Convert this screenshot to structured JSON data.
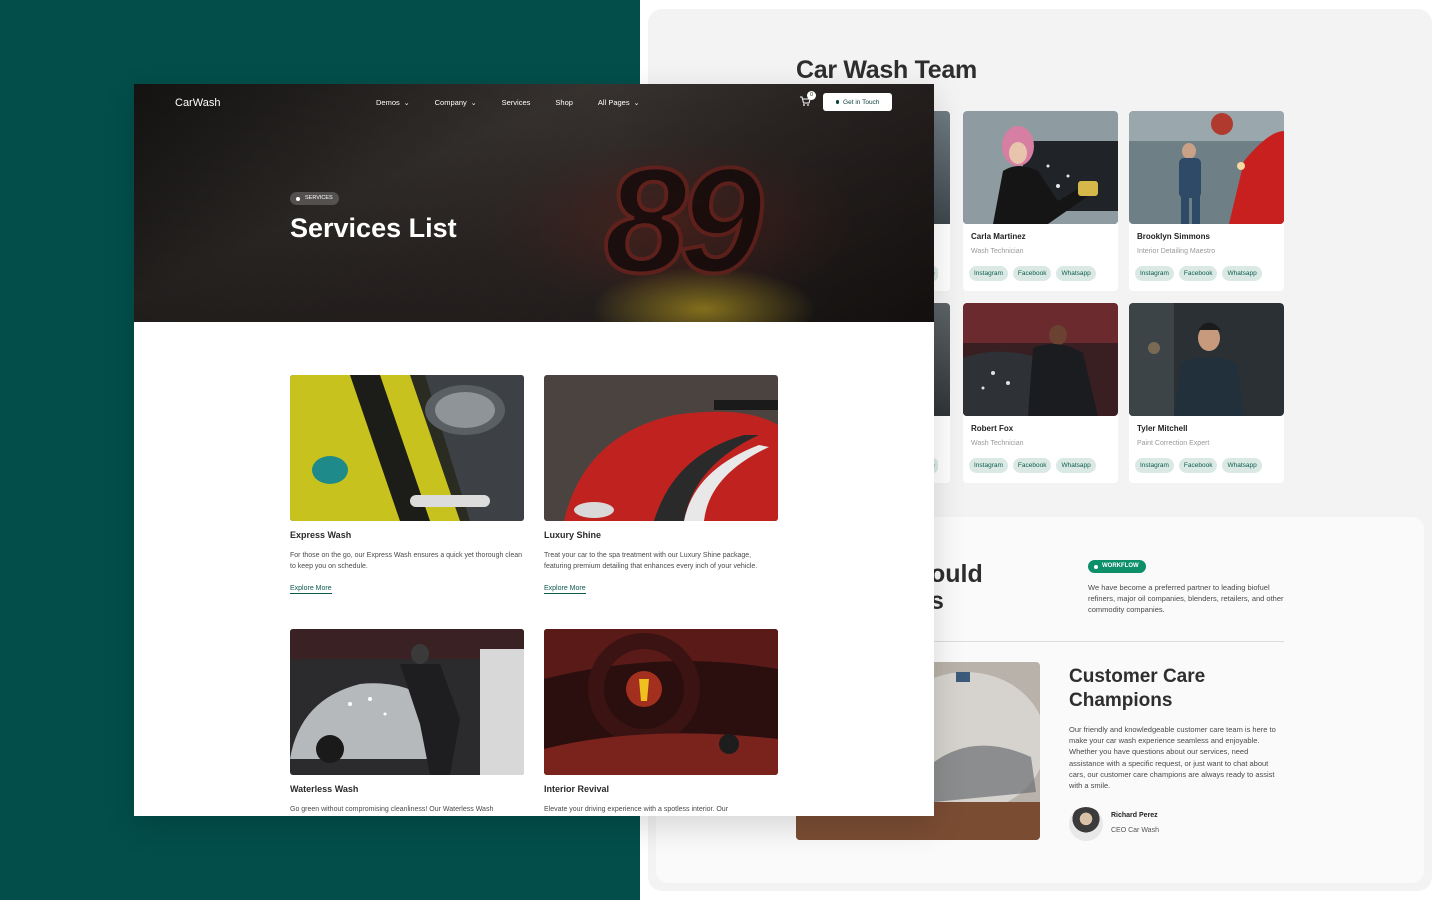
{
  "back_panel": {
    "team_title": "Car Wash Team",
    "members": [
      {
        "name": "Carla Martinez",
        "role": "Wash Technician",
        "tags": [
          "Instagram",
          "Facebook",
          "Whatsapp"
        ]
      },
      {
        "name": "Brooklyn Simmons",
        "role": "Interior Detailing Maestro",
        "tags": [
          "Instagram",
          "Facebook",
          "Whatsapp"
        ]
      },
      {
        "name": "Robert Fox",
        "role": "Wash Technician",
        "tags": [
          "Instagram",
          "Facebook",
          "Whatsapp"
        ]
      },
      {
        "name": "Tyler Mitchell",
        "role": "Paint Correction Expert",
        "tags": [
          "Instagram",
          "Facebook",
          "Whatsapp"
        ]
      }
    ],
    "partial_tag_fragment": "p",
    "workflow": {
      "heading_line1": "ould",
      "heading_line2": "s",
      "badge": "WORKFLOW",
      "text": "We have become a preferred partner to leading biofuel refiners, major oil companies, blenders, retailers, and other commodity companies."
    },
    "care": {
      "title": "Customer Care Champions",
      "text": "Our friendly and knowledgeable customer care team is here to make your car wash experience seamless and enjoyable. Whether you have questions about our services, need assistance with a specific request, or just want to chat about cars, our customer care champions are always ready to assist with a smile.",
      "person_name": "Richard Perez",
      "person_role": "CEO Car Wash"
    }
  },
  "front": {
    "logo": "CarWash",
    "nav": [
      {
        "label": "Demos",
        "has_dropdown": true
      },
      {
        "label": "Company",
        "has_dropdown": true
      },
      {
        "label": "Services",
        "has_dropdown": false
      },
      {
        "label": "Shop",
        "has_dropdown": false
      },
      {
        "label": "All Pages",
        "has_dropdown": true
      }
    ],
    "cart_count": "0",
    "cta": "Get in Touch",
    "breadcrumb": "SERVICES",
    "hero_title": "Services List",
    "hero_number": "89",
    "services": [
      {
        "title": "Express Wash",
        "desc": "For those on the go, our Express Wash ensures a quick yet thorough clean to keep you on schedule.",
        "link": "Explore More"
      },
      {
        "title": "Luxury Shine",
        "desc": "Treat your car to the spa treatment with our Luxury Shine package, featuring premium detailing that enhances every inch of your vehicle.",
        "link": "Explore More"
      },
      {
        "title": "Waterless Wash",
        "desc": "Go green without compromising cleanliness! Our Waterless Wash",
        "link": ""
      },
      {
        "title": "Interior Revival",
        "desc": "Elevate your driving experience with a spotless interior. Our",
        "link": ""
      }
    ]
  },
  "colors": {
    "brand_dark": "#034e4a",
    "accent_green": "#0d8f6a",
    "tag_bg": "#dbe9e4"
  }
}
